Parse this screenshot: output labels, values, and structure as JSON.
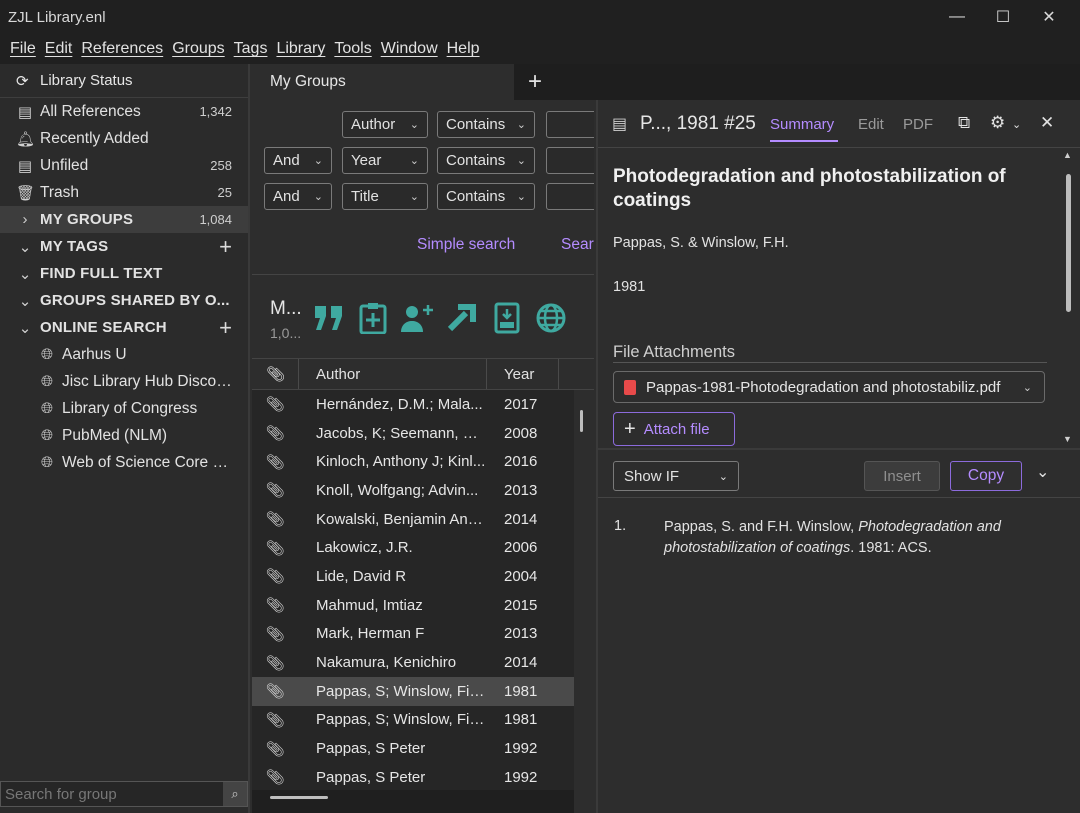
{
  "window": {
    "title": "ZJL Library.enl",
    "min_glyph": "—",
    "max_glyph": "☐",
    "close_glyph": "✕"
  },
  "menu": [
    "File",
    "Edit",
    "References",
    "Groups",
    "Tags",
    "Library",
    "Tools",
    "Window",
    "Help"
  ],
  "sidebar": {
    "status_label": "Library Status",
    "items": [
      {
        "label": "All References",
        "count": "1,342",
        "icon": "clipboard-icon"
      },
      {
        "label": "Recently Added",
        "count": "",
        "icon": "bell-icon"
      },
      {
        "label": "Unfiled",
        "count": "258",
        "icon": "clipboard-icon"
      },
      {
        "label": "Trash",
        "count": "25",
        "icon": "trash-icon"
      }
    ],
    "groups": [
      {
        "label": "MY GROUPS",
        "count": "1,084",
        "expanded": false,
        "plus": false
      },
      {
        "label": "MY TAGS",
        "count": "",
        "expanded": true,
        "plus": true
      },
      {
        "label": "FIND FULL TEXT",
        "count": "",
        "expanded": true,
        "plus": false
      },
      {
        "label": "GROUPS SHARED BY O...",
        "count": "",
        "expanded": true,
        "plus": false
      },
      {
        "label": "ONLINE SEARCH",
        "count": "",
        "expanded": true,
        "plus": true
      }
    ],
    "online": [
      "Aarhus U",
      "Jisc Library Hub Discover",
      "Library of Congress",
      "PubMed (NLM)",
      "Web of Science Core C..."
    ],
    "search_placeholder": "Search for group"
  },
  "tabs": {
    "current": "My Groups",
    "add": "+"
  },
  "search": {
    "rows": [
      {
        "bool": "",
        "field": "Author",
        "op": "Contains"
      },
      {
        "bool": "And",
        "field": "Year",
        "op": "Contains"
      },
      {
        "bool": "And",
        "field": "Title",
        "op": "Contains"
      }
    ],
    "simple_search": "Simple search",
    "search_partial": "Sear"
  },
  "group_summary": {
    "name": "M...",
    "count": "1,0..."
  },
  "list": {
    "headers": {
      "author": "Author",
      "year": "Year"
    },
    "rows": [
      {
        "author": "Hernández, D.M.; Mala...",
        "year": "2017"
      },
      {
        "author": "Jacobs, K; Seemann, R; ...",
        "year": "2008"
      },
      {
        "author": "Kinloch, Anthony J; Kinl...",
        "year": "2016"
      },
      {
        "author": "Knoll, Wolfgang; Advin...",
        "year": "2013"
      },
      {
        "author": "Kowalski, Benjamin And...",
        "year": "2014"
      },
      {
        "author": "Lakowicz, J.R.",
        "year": "2006"
      },
      {
        "author": "Lide, David R",
        "year": "2004"
      },
      {
        "author": "Mahmud, Imtiaz",
        "year": "2015"
      },
      {
        "author": "Mark, Herman F",
        "year": "2013"
      },
      {
        "author": "Nakamura, Kenichiro",
        "year": "2014"
      },
      {
        "author": "Pappas, S; Winslow, Fiel...",
        "year": "1981",
        "selected": true
      },
      {
        "author": "Pappas, S; Winslow, Fiel...",
        "year": "1981"
      },
      {
        "author": "Pappas, S Peter",
        "year": "1992"
      },
      {
        "author": "Pappas, S Peter",
        "year": "1992"
      }
    ]
  },
  "reference": {
    "header_title": "P..., 1981 #25",
    "tabs": {
      "summary": "Summary",
      "edit": "Edit",
      "pdf": "PDF"
    },
    "title": "Photodegradation and photostabilization of coatings",
    "authors": "Pappas, S. & Winslow, F.H.",
    "year": "1981",
    "file_attachments_label": "File Attachments",
    "attachment": "Pappas-1981-Photodegradation and photostabiliz.pdf",
    "attach_button": "Attach file"
  },
  "citation_bar": {
    "style": "Show IF",
    "insert": "Insert",
    "copy": "Copy"
  },
  "citation": {
    "number": "1.",
    "lead": "Pappas, S. and F.H. Winslow, ",
    "title_italic": "Photodegradation and photostabilization of coatings",
    "tail": ". 1981: ACS."
  },
  "colors": {
    "accent": "#b48cff",
    "teal_icons": "#3fa9a0",
    "pdf_red": "#e84a4a"
  }
}
